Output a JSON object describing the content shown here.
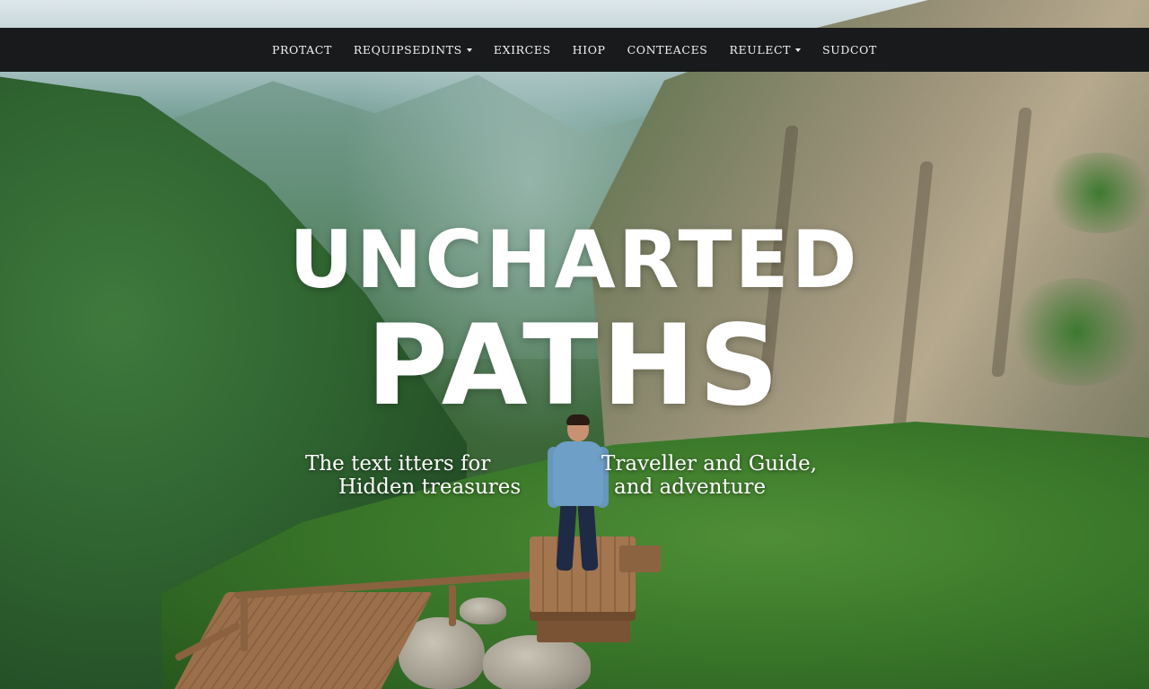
{
  "nav": {
    "items": [
      {
        "label": "PROTACT",
        "has_dropdown": false
      },
      {
        "label": "REQUIPSEDINTS",
        "has_dropdown": true
      },
      {
        "label": "EXIRCES",
        "has_dropdown": false
      },
      {
        "label": "HIOP",
        "has_dropdown": false
      },
      {
        "label": "CONTEACES",
        "has_dropdown": false
      },
      {
        "label": "REULECT",
        "has_dropdown": true
      },
      {
        "label": "SUDCOT",
        "has_dropdown": false
      }
    ]
  },
  "hero": {
    "title_line1": "UNCHARTED",
    "title_line2": "PATHS",
    "tagline": {
      "line1_left": "The text itters for",
      "line1_right": "Traveller and Guide,",
      "line2_left": "Hidden treasures",
      "line2_right": "and adventure"
    }
  },
  "colors": {
    "navbar_bg": "#181a1b",
    "nav_text": "#f2f2f2",
    "hero_text": "#ffffff"
  }
}
